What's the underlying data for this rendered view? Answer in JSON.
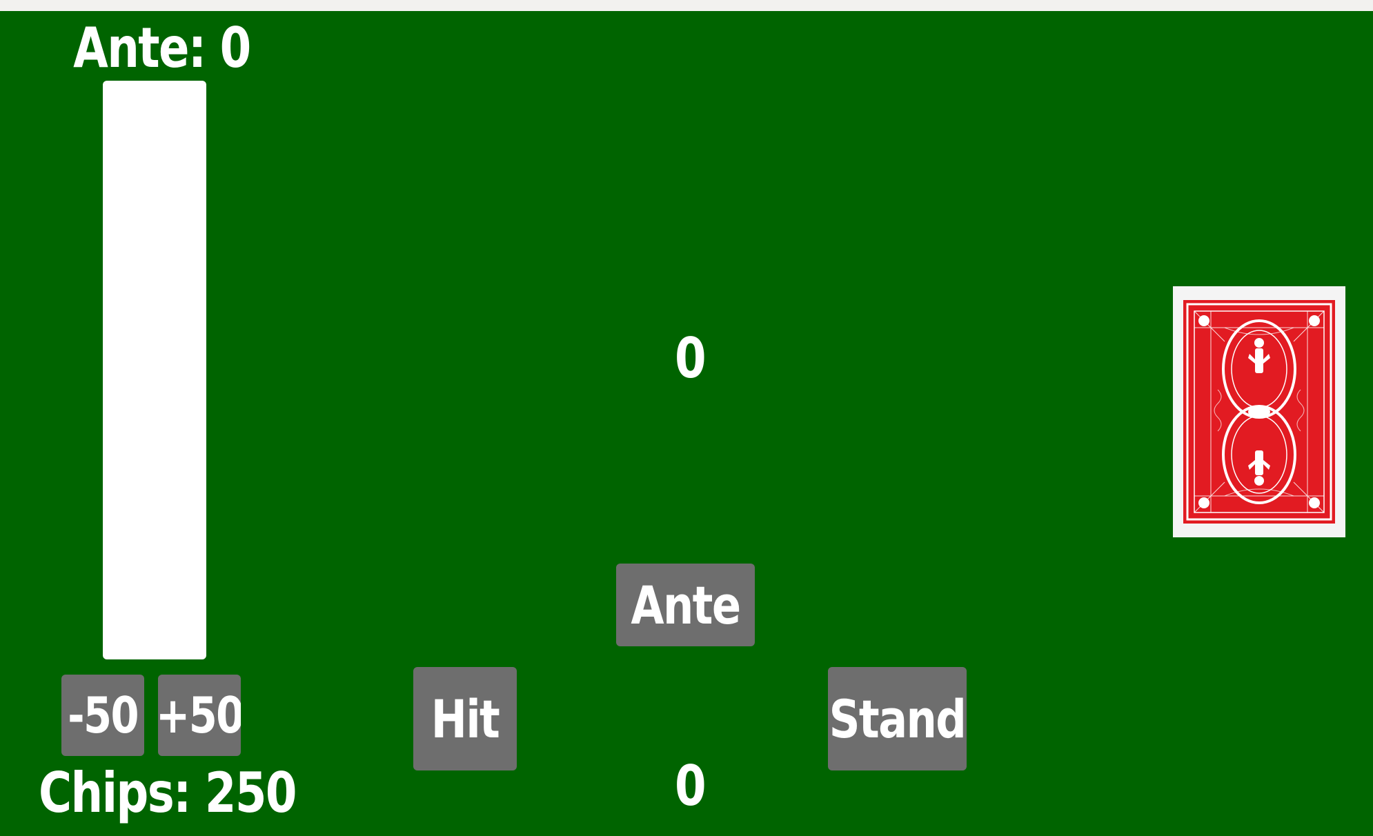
{
  "ante": {
    "label": "Ante: 0",
    "value": 0
  },
  "chips": {
    "label": "Chips: 250",
    "value": 250
  },
  "bet_controls": {
    "minus_label": "-50",
    "plus_label": "+50"
  },
  "actions": {
    "ante_label": "Ante",
    "hit_label": "Hit",
    "stand_label": "Stand"
  },
  "scores": {
    "dealer": "0",
    "player": "0"
  },
  "deck": {
    "icon": "card-back-icon",
    "color": "#e21b22"
  },
  "colors": {
    "table": "#006400",
    "button": "#6e6e6e",
    "text": "#ffffff"
  }
}
